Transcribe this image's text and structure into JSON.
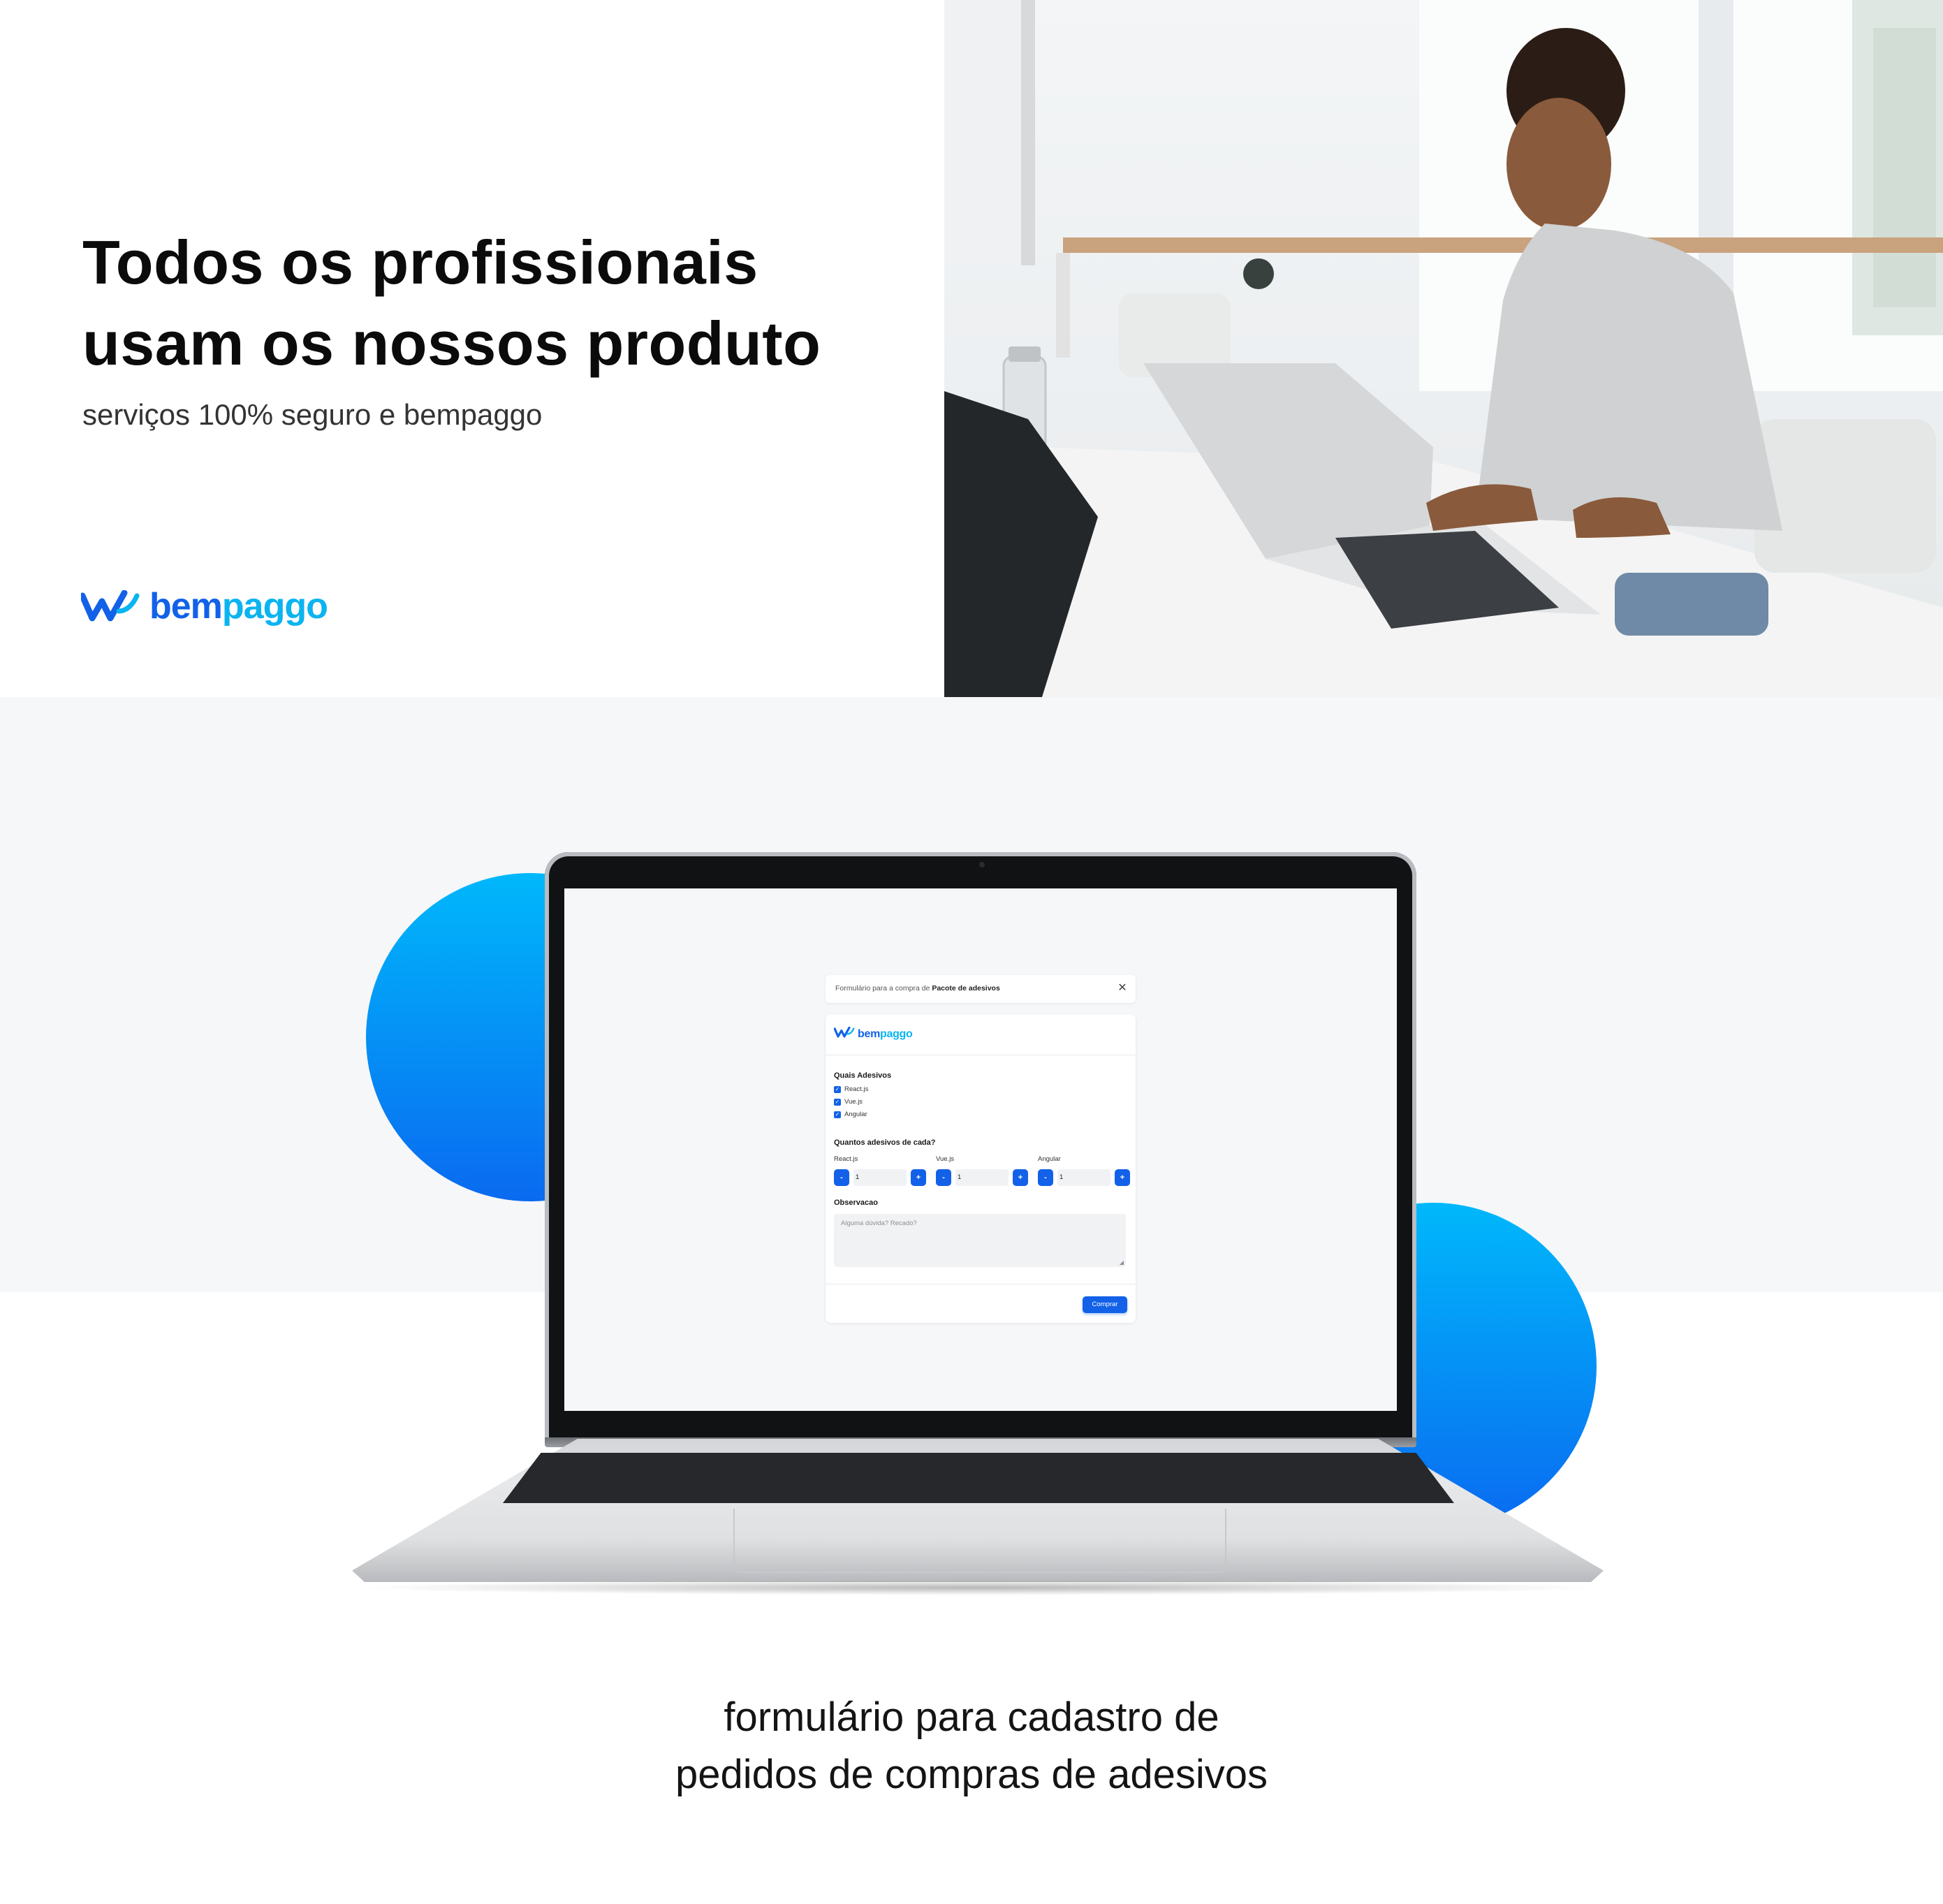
{
  "hero": {
    "title_line1": "Todos os profissionais",
    "title_line2": "usam os nossos produto",
    "subtitle": "serviços 100% seguro e bempaggo"
  },
  "brand": {
    "part1": "bem",
    "part2": "paggo",
    "bem_color": "#1261e8",
    "paggo_color": "#0ab4f0"
  },
  "form": {
    "topbar": {
      "prefix": "Formulário para a compra de",
      "product": "Pacote de adesivos"
    },
    "section_stickers": "Quais Adesivos",
    "options": [
      {
        "label": "React.js",
        "checked": true
      },
      {
        "label": "Vue.js",
        "checked": true
      },
      {
        "label": "Angular",
        "checked": true
      }
    ],
    "section_quantity": "Quantos adesivos de cada?",
    "steppers": [
      {
        "label": "React.js",
        "value": "1",
        "minus": "-",
        "plus": "+"
      },
      {
        "label": "Vue.js",
        "value": "1",
        "minus": "-",
        "plus": "+"
      },
      {
        "label": "Angular",
        "value": "1",
        "minus": "-",
        "plus": "+"
      }
    ],
    "notes_label": "Observacao",
    "notes_placeholder": "Alguma dúvida? Recado?",
    "submit": "Comprar"
  },
  "caption": {
    "line1": "formulário para cadastro de",
    "line2": "pedidos de compras de adesivos"
  },
  "colors": {
    "accent": "#1261e8",
    "accent_light": "#00b8fb",
    "band": "#f6f7f9"
  }
}
